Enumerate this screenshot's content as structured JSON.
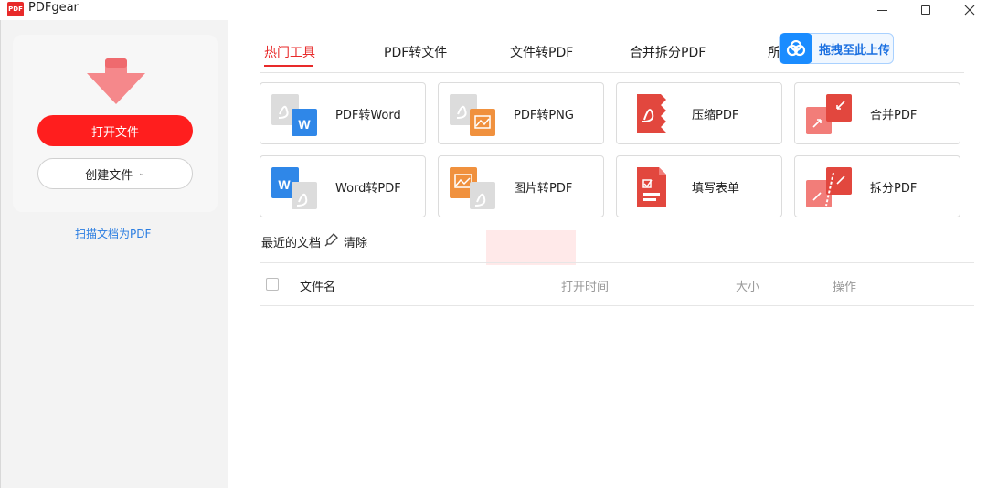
{
  "window": {
    "title": "PDFgear",
    "logo_text": "PDF"
  },
  "sidebar": {
    "open_button": "打开文件",
    "create_button": "创建文件",
    "scan_link": "扫描文档为PDF"
  },
  "tabs": [
    {
      "label": "热门工具",
      "active": true
    },
    {
      "label": "PDF转文件"
    },
    {
      "label": "文件转PDF"
    },
    {
      "label": "合并拆分PDF"
    },
    {
      "label": "所"
    }
  ],
  "upload_badge": {
    "label": "拖拽至此上传"
  },
  "tools": [
    {
      "label": "PDF转Word",
      "icon": "pdf-to-word-icon"
    },
    {
      "label": "PDF转PNG",
      "icon": "pdf-to-png-icon"
    },
    {
      "label": "压缩PDF",
      "icon": "compress-pdf-icon"
    },
    {
      "label": "合并PDF",
      "icon": "merge-pdf-icon"
    },
    {
      "label": "Word转PDF",
      "icon": "word-to-pdf-icon"
    },
    {
      "label": "图片转PDF",
      "icon": "image-to-pdf-icon"
    },
    {
      "label": "填写表单",
      "icon": "fill-form-icon"
    },
    {
      "label": "拆分PDF",
      "icon": "split-pdf-icon"
    }
  ],
  "recent": {
    "title": "最近的文档",
    "clear": "清除",
    "columns": {
      "name": "文件名",
      "open_time": "打开时间",
      "size": "大小",
      "actions": "操作"
    }
  },
  "colors": {
    "accent": "#e82a2a",
    "primary_button": "#ff1e1e",
    "link": "#2a7de1",
    "upload_blue": "#1a8cff"
  }
}
